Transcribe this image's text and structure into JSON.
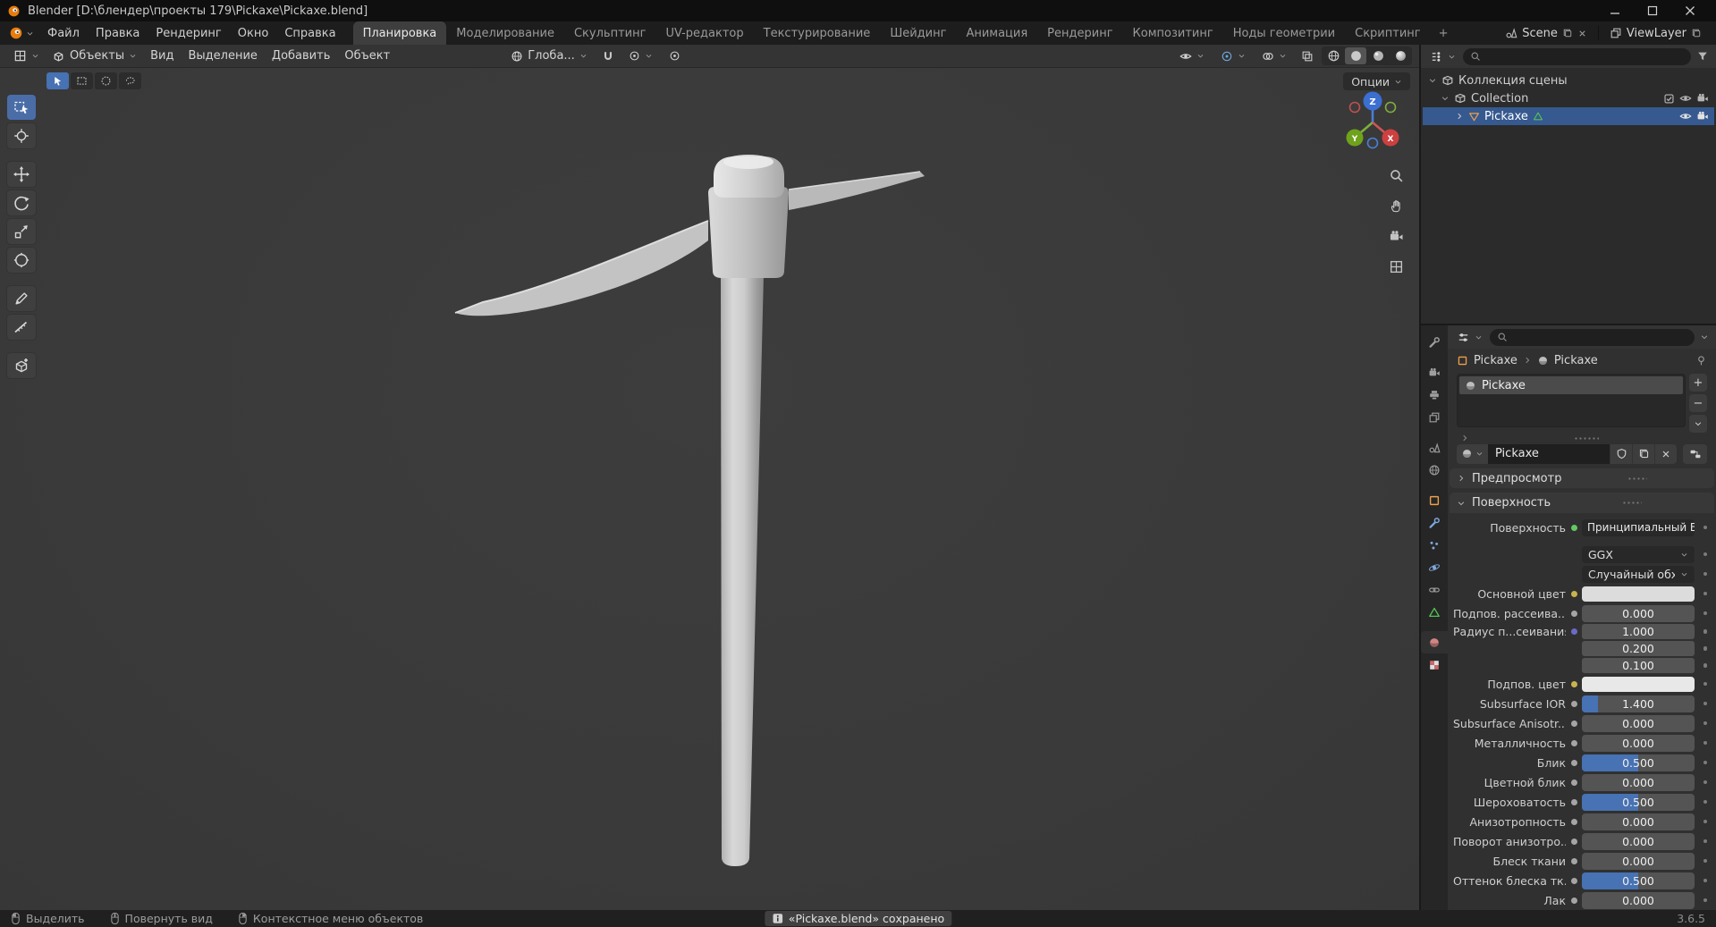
{
  "window": {
    "title": "Blender [D:\\блендер\\проекты 179\\Pickaxe\\Pickaxe.blend]"
  },
  "topbar": {
    "menus": [
      "Файл",
      "Правка",
      "Рендеринг",
      "Окно",
      "Справка"
    ],
    "workspaces": [
      "Планировка",
      "Моделирование",
      "Скульптинг",
      "UV-редактор",
      "Текстурирование",
      "Шейдинг",
      "Анимация",
      "Рендеринг",
      "Композитинг",
      "Ноды геометрии",
      "Скриптинг"
    ],
    "add_tab": "+",
    "scene": "Scene",
    "viewlayer": "ViewLayer"
  },
  "viewport": {
    "header": {
      "mode": "Объекты",
      "menus": [
        "Вид",
        "Выделение",
        "Добавить",
        "Объект"
      ],
      "orientation": "Глоба...",
      "options_label": "Опции"
    },
    "gizmo": {
      "x": "X",
      "y": "Y",
      "z": "Z"
    }
  },
  "outliner": {
    "scene_collection": "Коллекция сцены",
    "collection": "Collection",
    "object": "Pickaxe"
  },
  "properties": {
    "breadcrumb": {
      "object": "Pickaxe",
      "material": "Pickaxe"
    },
    "slot": "Pickaxe",
    "name_field": "Pickaxe",
    "buttons": {
      "add": "+",
      "remove": "−"
    },
    "sections": {
      "preview": "Предпросмотр",
      "surface": "Поверхность"
    },
    "surface_row": {
      "label": "Поверхность",
      "value": "Принципиальный BSDF",
      "socket": "#63C763"
    },
    "enums": {
      "distribution": "GGX",
      "subsurface_method": "Случайный обход"
    },
    "accent": "#4772B3",
    "rows": [
      {
        "label": "Основной цвет",
        "type": "color",
        "swatch": "#DCDCDC",
        "socket": "#CBB24D"
      },
      {
        "label": "Подпов. рассеива...",
        "value": "0.000",
        "fill": 0,
        "socket": "#A5A5A5"
      },
      {
        "label": "Радиус п...сеивания",
        "value": "1.000",
        "fill": 0,
        "socket": "#6B6BC7"
      },
      {
        "label": "",
        "value": "0.200",
        "fill": 0,
        "socket": ""
      },
      {
        "label": "",
        "value": "0.100",
        "fill": 0,
        "socket": ""
      },
      {
        "label": "Подпов. цвет",
        "type": "color",
        "swatch": "#E8E8E8",
        "socket": "#CBB24D"
      },
      {
        "label": "Subsurface IOR",
        "value": "1.400",
        "fill": 14,
        "socket": "#A5A5A5"
      },
      {
        "label": "Subsurface Anisotr...",
        "value": "0.000",
        "fill": 0,
        "socket": "#A5A5A5"
      },
      {
        "label": "Металличность",
        "value": "0.000",
        "fill": 0,
        "socket": "#A5A5A5"
      },
      {
        "label": "Блик",
        "value": "0.500",
        "fill": 50,
        "socket": "#A5A5A5"
      },
      {
        "label": "Цветной блик",
        "value": "0.000",
        "fill": 0,
        "socket": "#A5A5A5"
      },
      {
        "label": "Шероховатость",
        "value": "0.500",
        "fill": 50,
        "socket": "#A5A5A5"
      },
      {
        "label": "Анизотропность",
        "value": "0.000",
        "fill": 0,
        "socket": "#A5A5A5"
      },
      {
        "label": "Поворот анизотро...",
        "value": "0.000",
        "fill": 0,
        "socket": "#A5A5A5"
      },
      {
        "label": "Блеск ткани",
        "value": "0.000",
        "fill": 0,
        "socket": "#A5A5A5"
      },
      {
        "label": "Оттенок блеска тк...",
        "value": "0.500",
        "fill": 50,
        "socket": "#A5A5A5"
      },
      {
        "label": "Лак",
        "value": "0.000",
        "fill": 0,
        "socket": "#A5A5A5"
      }
    ]
  },
  "statusbar": {
    "hints": [
      "Выделить",
      "Повернуть вид",
      "Контекстное меню объектов"
    ],
    "notification": "«Pickaxe.blend» сохранено",
    "version": "3.6.5"
  }
}
